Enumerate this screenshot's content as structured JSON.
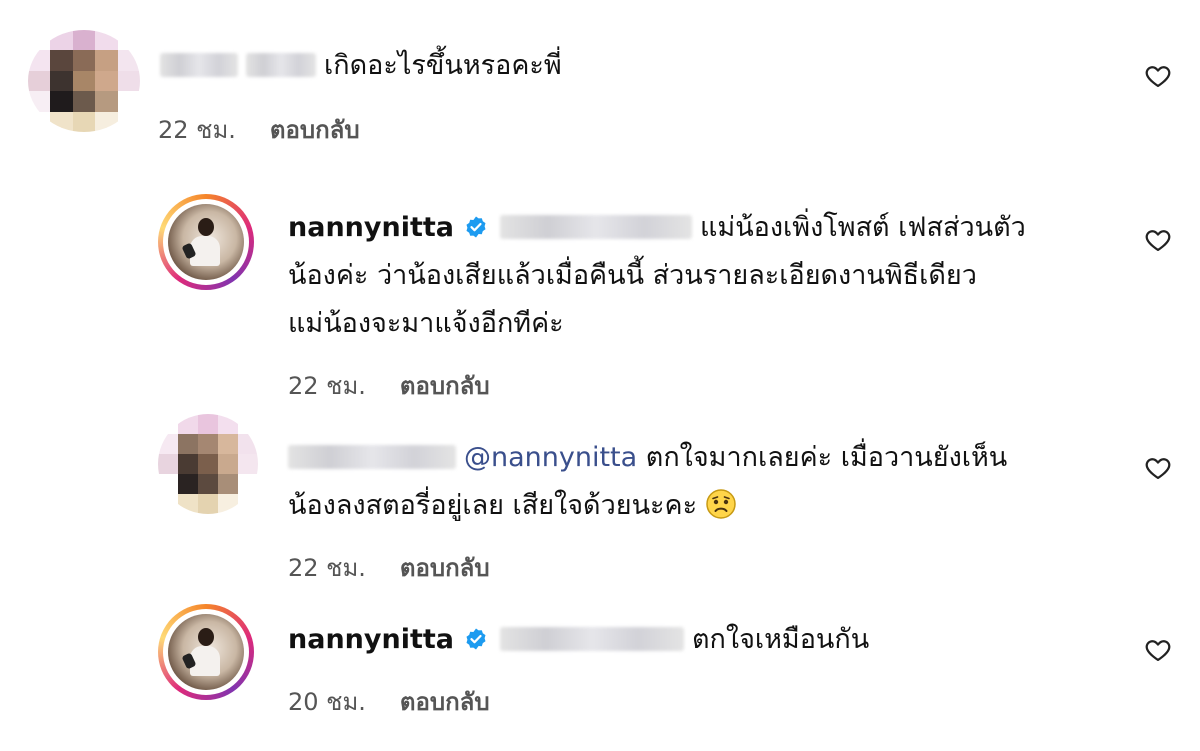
{
  "comments": [
    {
      "username": "",
      "text": "เกิดอะไรขึ้นหรอคะพี่",
      "time": "22 ชม.",
      "reply_label": "ตอบกลับ",
      "avatar": "pixelated"
    },
    {
      "username": "nannynitta",
      "verified": true,
      "lines": [
        "แม่น้องเพิ่งโพสต์ เฟสส่วนตัว",
        "น้องค่ะ ว่าน้องเสียแล้วเมื่อคืนนี้ ส่วนรายละเอียดงานพิธีเดียว",
        "แม่น้องจะมาแจ้งอีกทีค่ะ"
      ],
      "time": "22 ชม.",
      "reply_label": "ตอบกลับ",
      "avatar": "story-ring"
    },
    {
      "username": "",
      "mention": "@nannynitta",
      "lines": [
        "ตกใจมากเลยค่ะ เมื่อวานยังเห็น",
        "น้องลงสตอรี่อยู่เลย เสียใจด้วยนะคะ"
      ],
      "emoji": "sad-face-emoji",
      "time": "22 ชม.",
      "reply_label": "ตอบกลับ",
      "avatar": "pixelated"
    },
    {
      "username": "nannynitta",
      "verified": true,
      "text": "ตกใจเหมือนกัน",
      "time": "20 ชม.",
      "reply_label": "ตอบกลับ",
      "avatar": "story-ring"
    }
  ],
  "icons": {
    "like": "heart-outline-icon",
    "verified": "verified-badge-icon"
  },
  "colors": {
    "verified": "#1d9bf0",
    "mention": "#3a4f8c",
    "meta": "#555555"
  }
}
